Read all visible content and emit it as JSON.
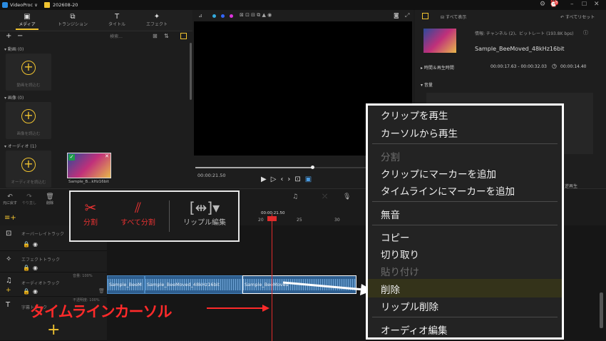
{
  "titlebar": {
    "app": "VideoProc ∨",
    "project": "202608-20",
    "notif_count": "8"
  },
  "tabs": [
    {
      "label": "メディア",
      "icon": "▣"
    },
    {
      "label": "トランジション",
      "icon": "⧉"
    },
    {
      "label": "タイトル",
      "icon": "T"
    },
    {
      "label": "エフェクト",
      "icon": "✦"
    }
  ],
  "media": {
    "search_placeholder": "検索..."
  },
  "library": {
    "video": {
      "header": "動画 (0)",
      "add_label": "動画を読込む"
    },
    "image": {
      "header": "画像 (0)",
      "add_label": "画像を読込む"
    },
    "audio": {
      "header": "オーディオ (1)",
      "add_label": "オーディオを読込む",
      "item_name": "Sample_B...kHz16bit"
    }
  },
  "preview": {
    "timecode": "00:00:21.50"
  },
  "inspector": {
    "show_all": "すべて表示",
    "reset_all": "すべてリセット",
    "info": "情報: チャンネル (2)、ビットレート (193.8K bps)",
    "filename": "Sample_BeeMoved_48kHz16bit",
    "time_section": "時間＆再生時間",
    "time_range": "00:00:17.63 - 00:00:32.03",
    "duration": "00:00:14.40",
    "volume_section": "音量",
    "partial_text": "逆再生"
  },
  "toolbar": {
    "undo": "元に戻す",
    "redo": "やり直し",
    "delete": "削除"
  },
  "callout": {
    "split": {
      "label": "分割",
      "icon": "scissors-icon"
    },
    "split_all": {
      "label": "すべて分割",
      "icon": "split-all-icon"
    },
    "ripple": {
      "label": "リップル編集",
      "icon": "ripple-edit-icon"
    }
  },
  "ruler": {
    "playhead_time": "00:00:21.50",
    "ticks": [
      "20",
      "25",
      "30"
    ]
  },
  "tracks": [
    {
      "name": "オーバーレイトラック",
      "icon": "⊡"
    },
    {
      "name": "エフェクトトラック",
      "icon": "✧"
    },
    {
      "name": "オーディオトラック",
      "icon": "♫",
      "volume": "音量: 100%"
    },
    {
      "name": "字幕トラック",
      "icon": "T",
      "volume": "不透明度: 100%"
    }
  ],
  "clips": [
    {
      "label": "Sample_BeeM"
    },
    {
      "label": "Sample_BeeMoved_48kHz16bit"
    },
    {
      "label": "Sample_BeeMoved"
    }
  ],
  "context_menu": {
    "play_clip": "クリップを再生",
    "play_from_cursor": "カーソルから再生",
    "split": "分割",
    "add_clip_marker": "クリップにマーカーを追加",
    "add_timeline_marker": "タイムラインにマーカーを追加",
    "mute": "無音",
    "copy": "コピー",
    "cut": "切り取り",
    "paste": "貼り付け",
    "delete": "削除",
    "ripple_delete": "リップル削除",
    "audio_edit": "オーディオ編集"
  },
  "annotation": "タイムラインカーソル",
  "colors": {
    "accent": "#f0c330",
    "annotation": "#ff2a2a",
    "clip": "#2e5e8f",
    "playhead": "#e02b2b"
  }
}
